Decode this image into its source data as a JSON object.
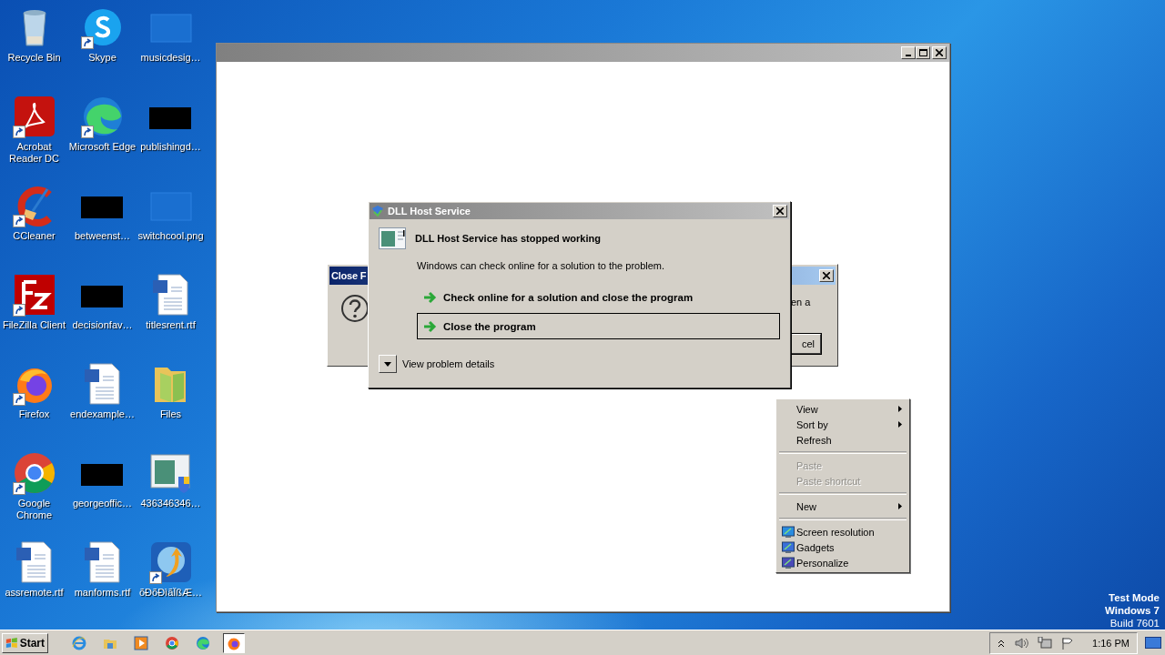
{
  "desktop_icons": [
    {
      "label": "Recycle Bin",
      "kind": "recycle",
      "shortcut": false
    },
    {
      "label": "Acrobat Reader DC",
      "kind": "acrobat",
      "shortcut": true
    },
    {
      "label": "CCleaner",
      "kind": "ccleaner",
      "shortcut": true
    },
    {
      "label": "FileZilla Client",
      "kind": "filezilla",
      "shortcut": true
    },
    {
      "label": "Firefox",
      "kind": "firefox",
      "shortcut": true
    },
    {
      "label": "Google Chrome",
      "kind": "chrome",
      "shortcut": true
    },
    {
      "label": "assremote.rtf",
      "kind": "document",
      "shortcut": false
    },
    {
      "label": "Skype",
      "kind": "skype",
      "shortcut": true
    },
    {
      "label": "Microsoft Edge",
      "kind": "edge",
      "shortcut": true
    },
    {
      "label": "betweenst…",
      "kind": "redacted",
      "shortcut": false
    },
    {
      "label": "decisionfav…",
      "kind": "redacted",
      "shortcut": false
    },
    {
      "label": "endexample…",
      "kind": "document",
      "shortcut": false
    },
    {
      "label": "georgeoffic…",
      "kind": "redacted",
      "shortcut": false
    },
    {
      "label": "manforms.rtf",
      "kind": "document",
      "shortcut": false
    },
    {
      "label": "musicdesig…",
      "kind": "blank",
      "shortcut": false
    },
    {
      "label": "publishingd…",
      "kind": "redacted",
      "shortcut": false
    },
    {
      "label": "switchcool.png",
      "kind": "blank",
      "shortcut": false
    },
    {
      "label": "titlesrent.rtf",
      "kind": "document",
      "shortcut": false
    },
    {
      "label": "Files",
      "kind": "folder",
      "shortcut": false
    },
    {
      "label": "436346346…",
      "kind": "installer",
      "shortcut": false
    },
    {
      "label": "õÐõÐìãÏßÆ…",
      "kind": "app",
      "shortcut": true
    }
  ],
  "back_dialog": {
    "title": "Close F",
    "text": "en a",
    "button": "cel"
  },
  "dll_dialog": {
    "title": "DLL Host Service",
    "heading": "DLL Host Service has stopped working",
    "text": "Windows can check online for a solution to the problem.",
    "options": [
      {
        "label": "Check online for a solution and close the program",
        "selected": false
      },
      {
        "label": "Close the program",
        "selected": true
      }
    ],
    "details": "View problem details"
  },
  "context_menu": {
    "items": [
      {
        "label": "View",
        "kind": "submenu",
        "disabled": false
      },
      {
        "label": "Sort by",
        "kind": "submenu",
        "disabled": false
      },
      {
        "label": "Refresh",
        "kind": "plain",
        "disabled": false
      },
      {
        "kind": "separator"
      },
      {
        "label": "Paste",
        "kind": "plain",
        "disabled": true
      },
      {
        "label": "Paste shortcut",
        "kind": "plain",
        "disabled": true
      },
      {
        "kind": "separator"
      },
      {
        "label": "New",
        "kind": "submenu",
        "disabled": false
      },
      {
        "kind": "separator"
      },
      {
        "label": "Screen resolution",
        "kind": "icon",
        "disabled": false
      },
      {
        "label": "Gadgets",
        "kind": "icon",
        "disabled": false
      },
      {
        "label": "Personalize",
        "kind": "icon",
        "disabled": false
      }
    ]
  },
  "watermark": [
    "Test Mode",
    "Windows 7",
    "Build 7601"
  ],
  "taskbar": {
    "start": "Start",
    "quick_launch": [
      {
        "kind": "ie",
        "selected": false
      },
      {
        "kind": "explorer",
        "selected": false
      },
      {
        "kind": "media",
        "selected": false
      },
      {
        "kind": "chrome",
        "selected": false
      },
      {
        "kind": "edge",
        "selected": false
      },
      {
        "kind": "firefox",
        "selected": true
      }
    ],
    "clock": "1:16 PM"
  }
}
